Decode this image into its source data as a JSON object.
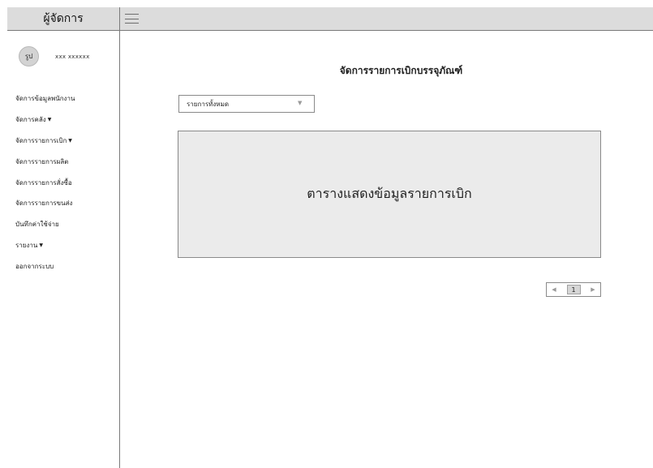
{
  "sidebar": {
    "title": "ผู้จัดการ",
    "profile": {
      "avatar_label": "รูป",
      "name": "xxx xxxxxx"
    },
    "items": [
      {
        "label": "จัดการข้อมูลพนักงาน",
        "caret": ""
      },
      {
        "label": "จัดการคลัง",
        "caret": "▼"
      },
      {
        "label": "จัดการรายการเบิก",
        "caret": "▼"
      },
      {
        "label": "จัดการรายการผลิต",
        "caret": ""
      },
      {
        "label": "จัดการรายการสั่งซื้อ",
        "caret": ""
      },
      {
        "label": "จัดการรายการขนส่ง",
        "caret": ""
      },
      {
        "label": "บันทึกค่าใช้จ่าย",
        "caret": ""
      },
      {
        "label": "รายงาน",
        "caret": "▼"
      },
      {
        "label": "ออกจากระบบ",
        "caret": ""
      }
    ]
  },
  "topbar": {
    "menu_icon": "hamburger-icon"
  },
  "main": {
    "title": "จัดการรายการเบิกบรรจุภัณฑ์",
    "filter": {
      "selected": "รายการทั้งหมด",
      "arrow": "▼"
    },
    "table_placeholder": "ตารางแสดงข้อมูลรายการเบิก",
    "pagination": {
      "prev": "◀",
      "current_page": "1",
      "next": "▶"
    }
  },
  "colors": {
    "header_bg": "#dcdcdc",
    "table_bg": "#ebebeb",
    "border": "#8a8a8a"
  }
}
